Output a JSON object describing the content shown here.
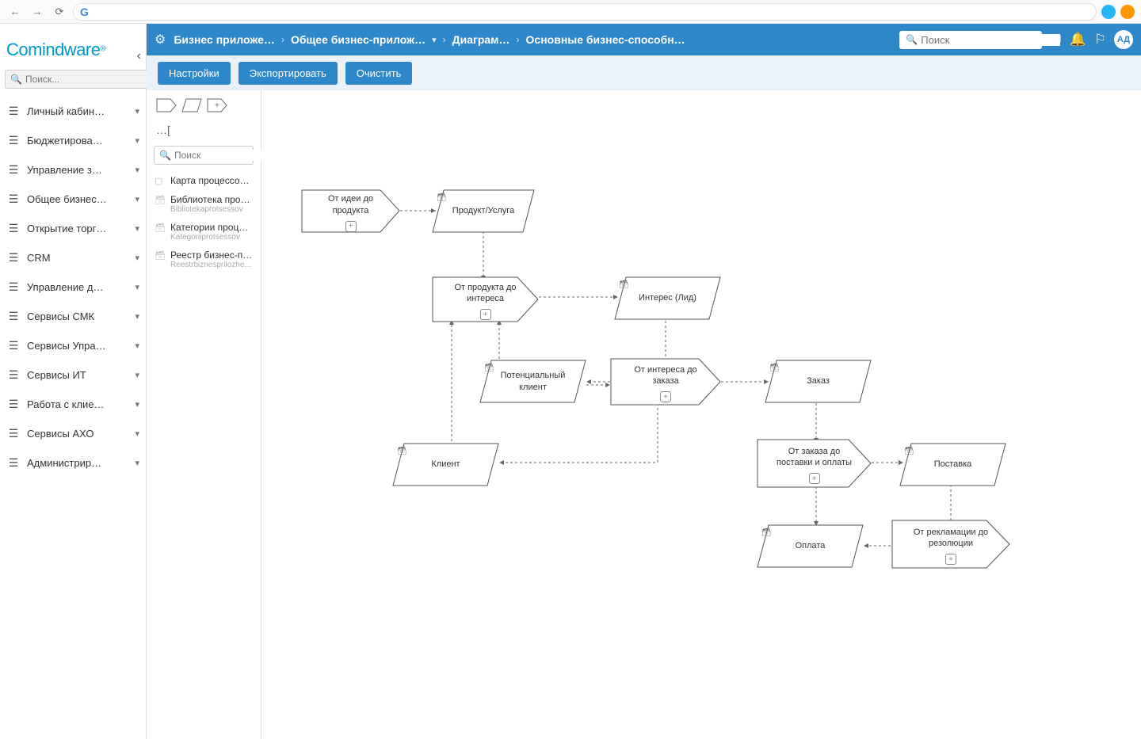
{
  "browser": {
    "url": ""
  },
  "logo": "Comindware",
  "sidebar": {
    "search_placeholder": "Поиск...",
    "items": [
      {
        "label": "Личный кабин…"
      },
      {
        "label": "Бюджетирова…"
      },
      {
        "label": "Управление з…"
      },
      {
        "label": "Общее бизнес…"
      },
      {
        "label": "Открытие торг…"
      },
      {
        "label": "CRM"
      },
      {
        "label": "Управление д…"
      },
      {
        "label": "Сервисы СМК"
      },
      {
        "label": "Сервисы Упра…"
      },
      {
        "label": "Сервисы ИТ"
      },
      {
        "label": "Работа с клие…"
      },
      {
        "label": "Сервисы АХО"
      },
      {
        "label": "Администрир…"
      }
    ]
  },
  "breadcrumb": [
    "Бизнес приложе…",
    "Общее бизнес-прилож…",
    "Диаграм…",
    "Основные бизнес-способн…"
  ],
  "top_search_placeholder": "Поиск",
  "avatar": "АД",
  "actions": [
    "Настройки",
    "Экспортировать",
    "Очистить"
  ],
  "palette": {
    "tree_toggle": "…[",
    "search_placeholder": "Поиск",
    "items": [
      {
        "title": "Карта процессов в…",
        "sub": "",
        "icon": "card"
      },
      {
        "title": "Библиотека проце…",
        "sub": "Bibliotekaprotsessov",
        "icon": "db"
      },
      {
        "title": "Категории процес…",
        "sub": "Kategoriiprotsessov",
        "icon": "db"
      },
      {
        "title": "Реестр бизнес-при…",
        "sub": "Reestrbiznesprilozhe…",
        "icon": "db"
      }
    ]
  },
  "nodes": {
    "idea_product": "От идеи до продукта",
    "product_service": "Продукт/Услуга",
    "product_interest": "От продукта до интереса",
    "interest_lead": "Интерес (Лид)",
    "potential_client": "Потенциальный клиент",
    "interest_order": "От интереса до заказа",
    "order": "Заказ",
    "client": "Клиент",
    "order_delivery": "От заказа до поставки и оплаты",
    "delivery": "Поставка",
    "payment": "Оплата",
    "complaint": "От рекламации до резолюции"
  }
}
